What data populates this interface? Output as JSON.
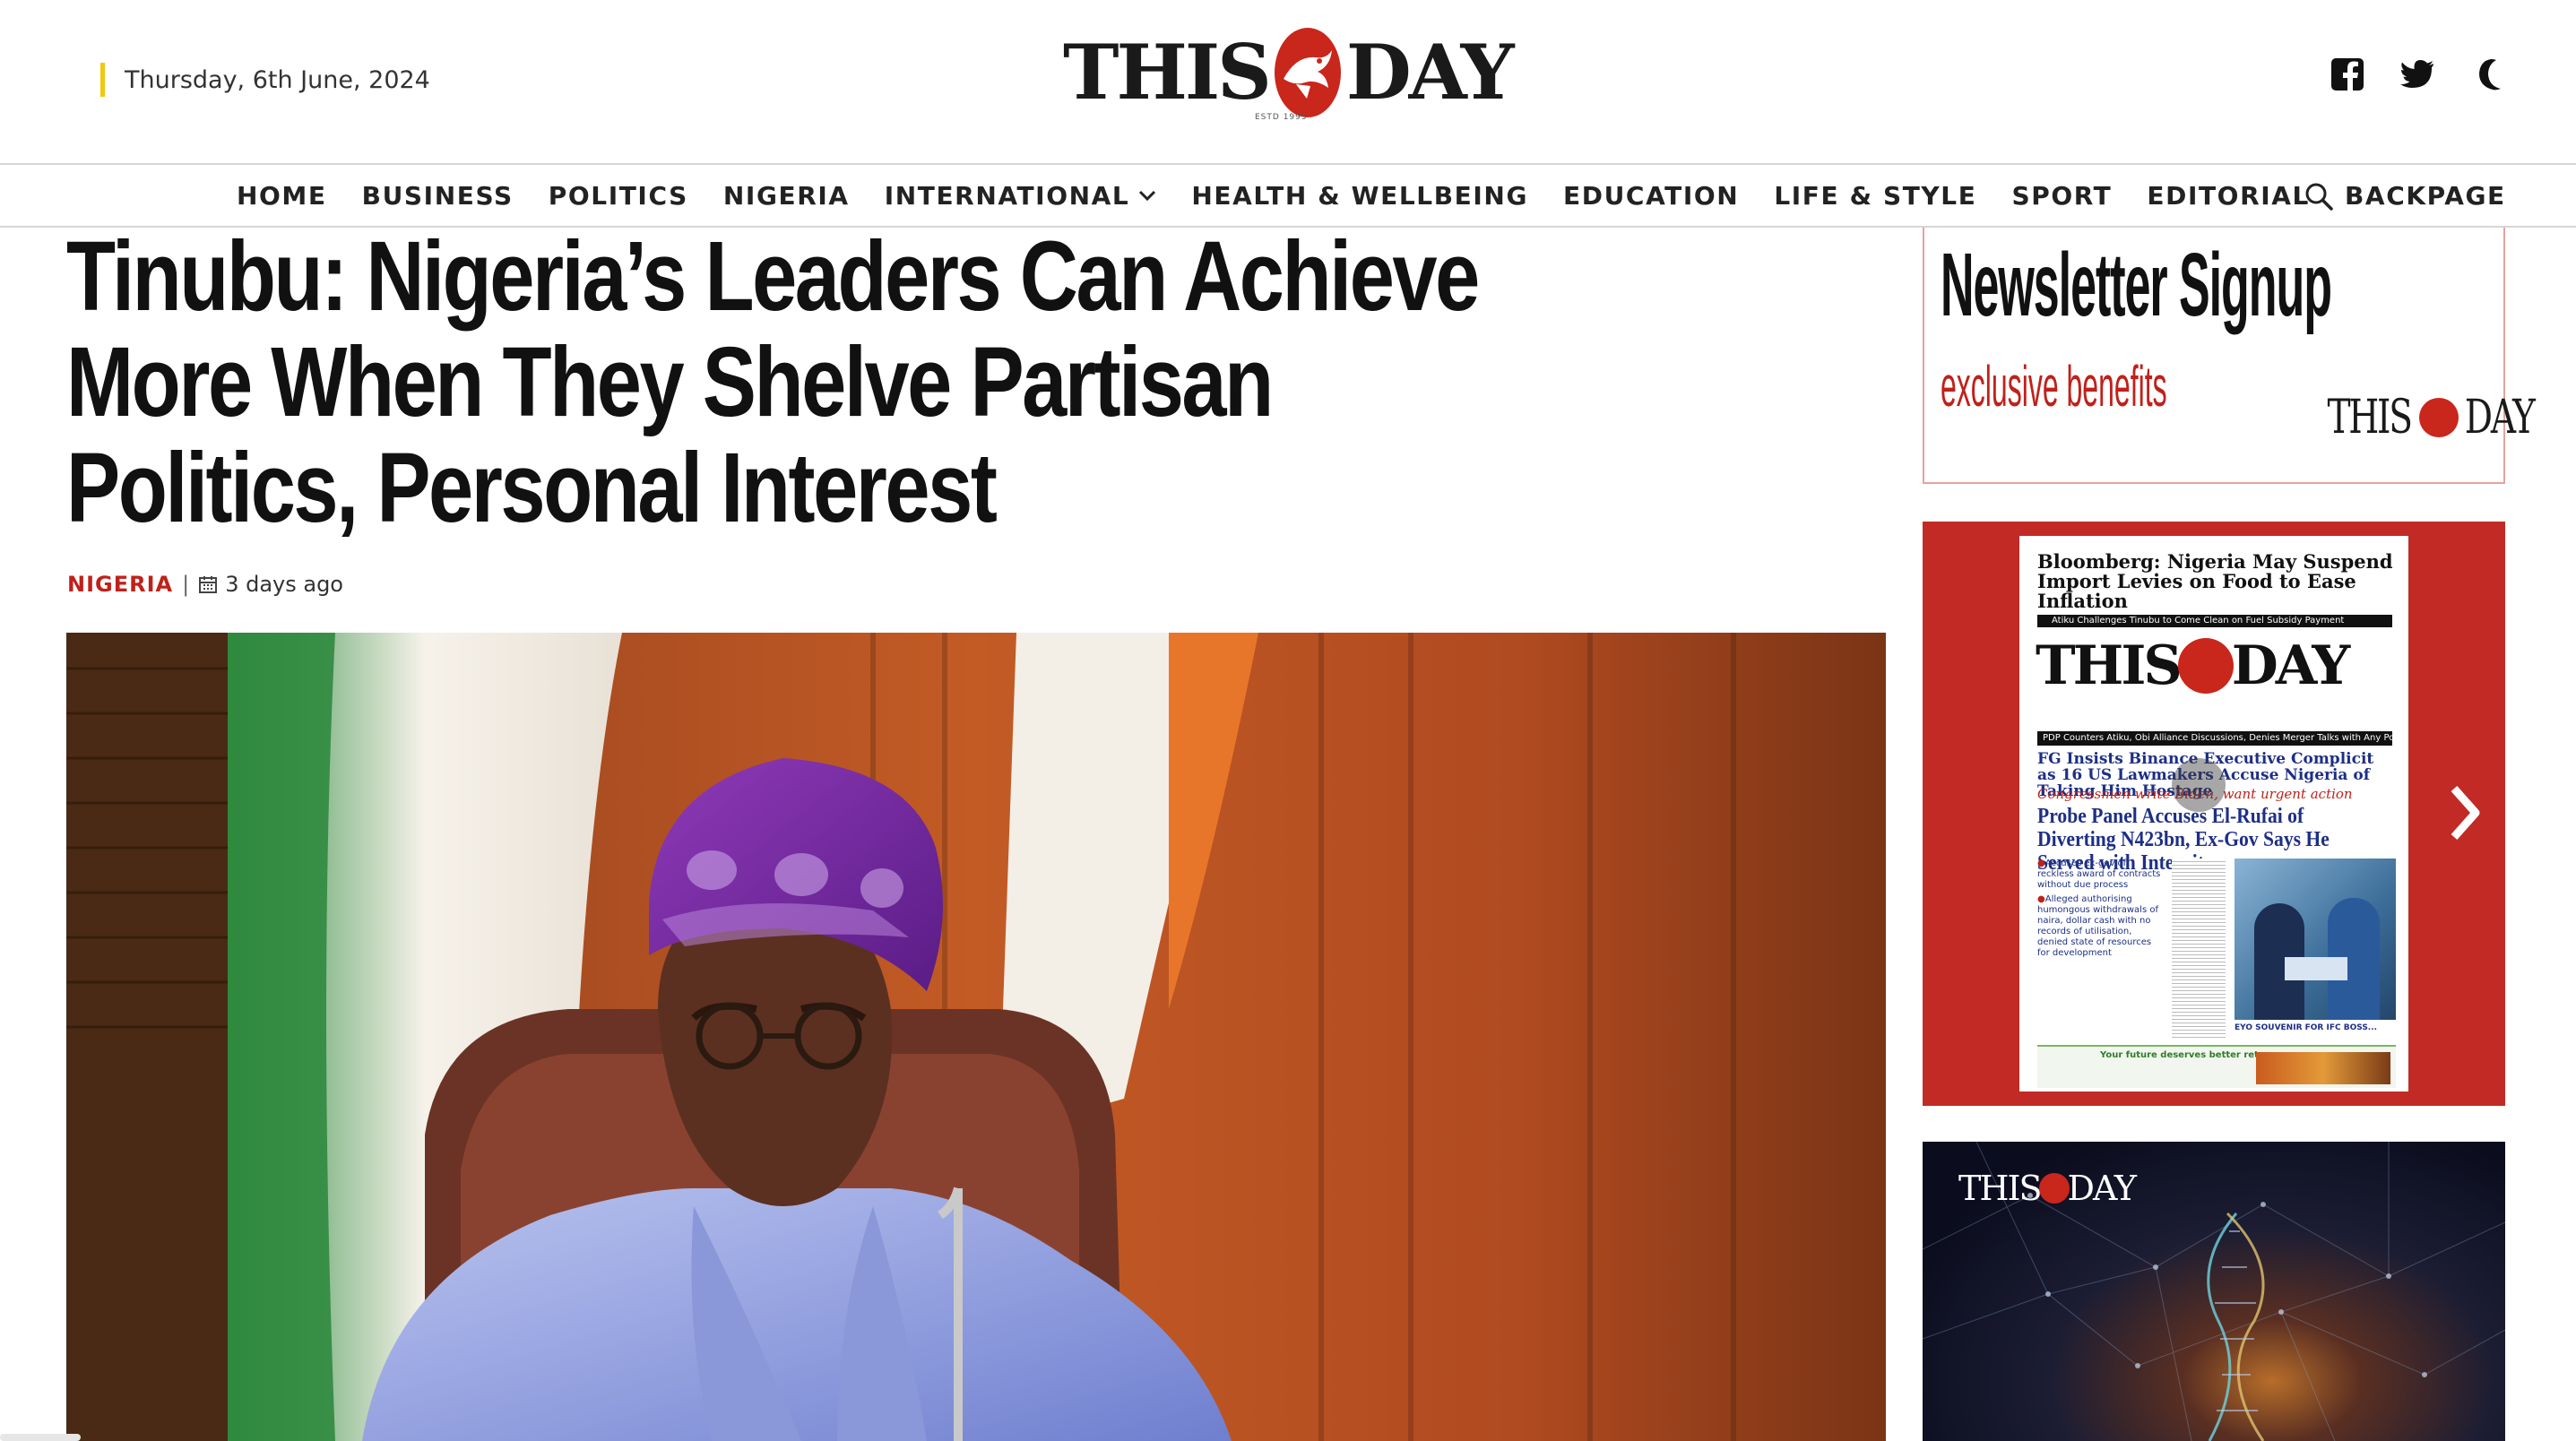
{
  "header": {
    "date": "Thursday, 6th June, 2024",
    "logo": {
      "left": "THIS",
      "right": "DAY",
      "tagline": "ESTD 1995"
    },
    "social_icons": [
      "facebook-icon",
      "twitter-icon",
      "dark-mode-moon-icon"
    ]
  },
  "nav": {
    "items": [
      {
        "label": "HOME"
      },
      {
        "label": "BUSINESS"
      },
      {
        "label": "POLITICS"
      },
      {
        "label": "NIGERIA"
      },
      {
        "label": "INTERNATIONAL",
        "has_dropdown": true
      },
      {
        "label": "HEALTH & WELLBEING"
      },
      {
        "label": "EDUCATION"
      },
      {
        "label": "LIFE & STYLE"
      },
      {
        "label": "SPORT"
      },
      {
        "label": "EDITORIAL"
      },
      {
        "label": "BACKPAGE"
      }
    ],
    "search_icon": "search-icon"
  },
  "article": {
    "headline": "Tinubu: Nigeria’s Leaders Can Achieve More When They Shelve Partisan Politics, Personal Interest",
    "category": "NIGERIA",
    "separator": "|",
    "time_ago": "3 days ago",
    "hero_image": "photo"
  },
  "sidebar": {
    "newsletter": {
      "title": "Newsletter Signup",
      "subtitle": "exclusive benefits",
      "logo_left": "THIS",
      "logo_right": "DAY"
    },
    "front_page": {
      "lead": "Bloomberg: Nigeria May Suspend Import Levies on Food to Ease Inflation",
      "strap": "Atiku Challenges Tinubu to Come Clean on Fuel Subsidy Payment",
      "mast_left": "THIS",
      "mast_right": "DAY",
      "kicker": "PDP Counters Atiku, Obi Alliance Discussions, Denies Merger Talks with Any Political Party",
      "headline_2": "FG Insists Binance Executive Complicit as 16 US Lawmakers Accuse Nigeria of Taking Him Hostage",
      "headline_2_sub": "Congressmen write Biden, want urgent action",
      "headline_3": "Probe Panel Accuses El-Rufai of Diverting N423bn, Ex-Gov Says He Served with Integrity",
      "bullets": [
        "Accuses ex-gov of reckless award of contracts without due process",
        "Alleged authorising humongous withdrawals of naira, dollar cash with no records of utilisation, denied state of resources for development"
      ],
      "photo_caption": "EYO SOUVENIR FOR IFC BOSS...",
      "ad_text": "Your future deserves better returns",
      "next_icon": "chevron-right-icon"
    },
    "promo": {
      "logo_left": "THIS",
      "logo_right": "DAY"
    }
  },
  "colors": {
    "accent_red": "#c0211a",
    "date_bar_yellow": "#f2c811",
    "paper_background_red": "#c22a25"
  }
}
